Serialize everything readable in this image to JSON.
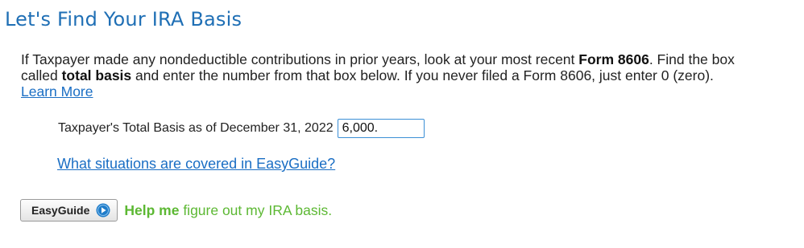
{
  "page": {
    "title": "Let's Find Your IRA Basis"
  },
  "intro": {
    "text_1": "If Taxpayer made any nondeductible contributions in prior years, look at your most recent ",
    "bold_form": "Form 8606",
    "text_2": ". Find the box called ",
    "bold_total_basis": "total basis",
    "text_3": " and enter the number from that box below. If you never filed a Form 8606, just enter 0 (zero). ",
    "learn_more_label": "Learn More"
  },
  "basis": {
    "label": "Taxpayer's Total Basis as of December 31, 2022",
    "value": "6,000."
  },
  "situations_link_label": "What situations are covered in EasyGuide?",
  "easyguide": {
    "button_label": "EasyGuide",
    "help_bold": "Help me",
    "help_rest": " figure out my IRA basis."
  },
  "colors": {
    "title": "#1f6fb5",
    "link": "#1a6ec4",
    "help_text": "#5cb833",
    "input_border": "#3b8fd6"
  },
  "icons": {
    "easyguide_button_icon": "play-circle-icon"
  }
}
